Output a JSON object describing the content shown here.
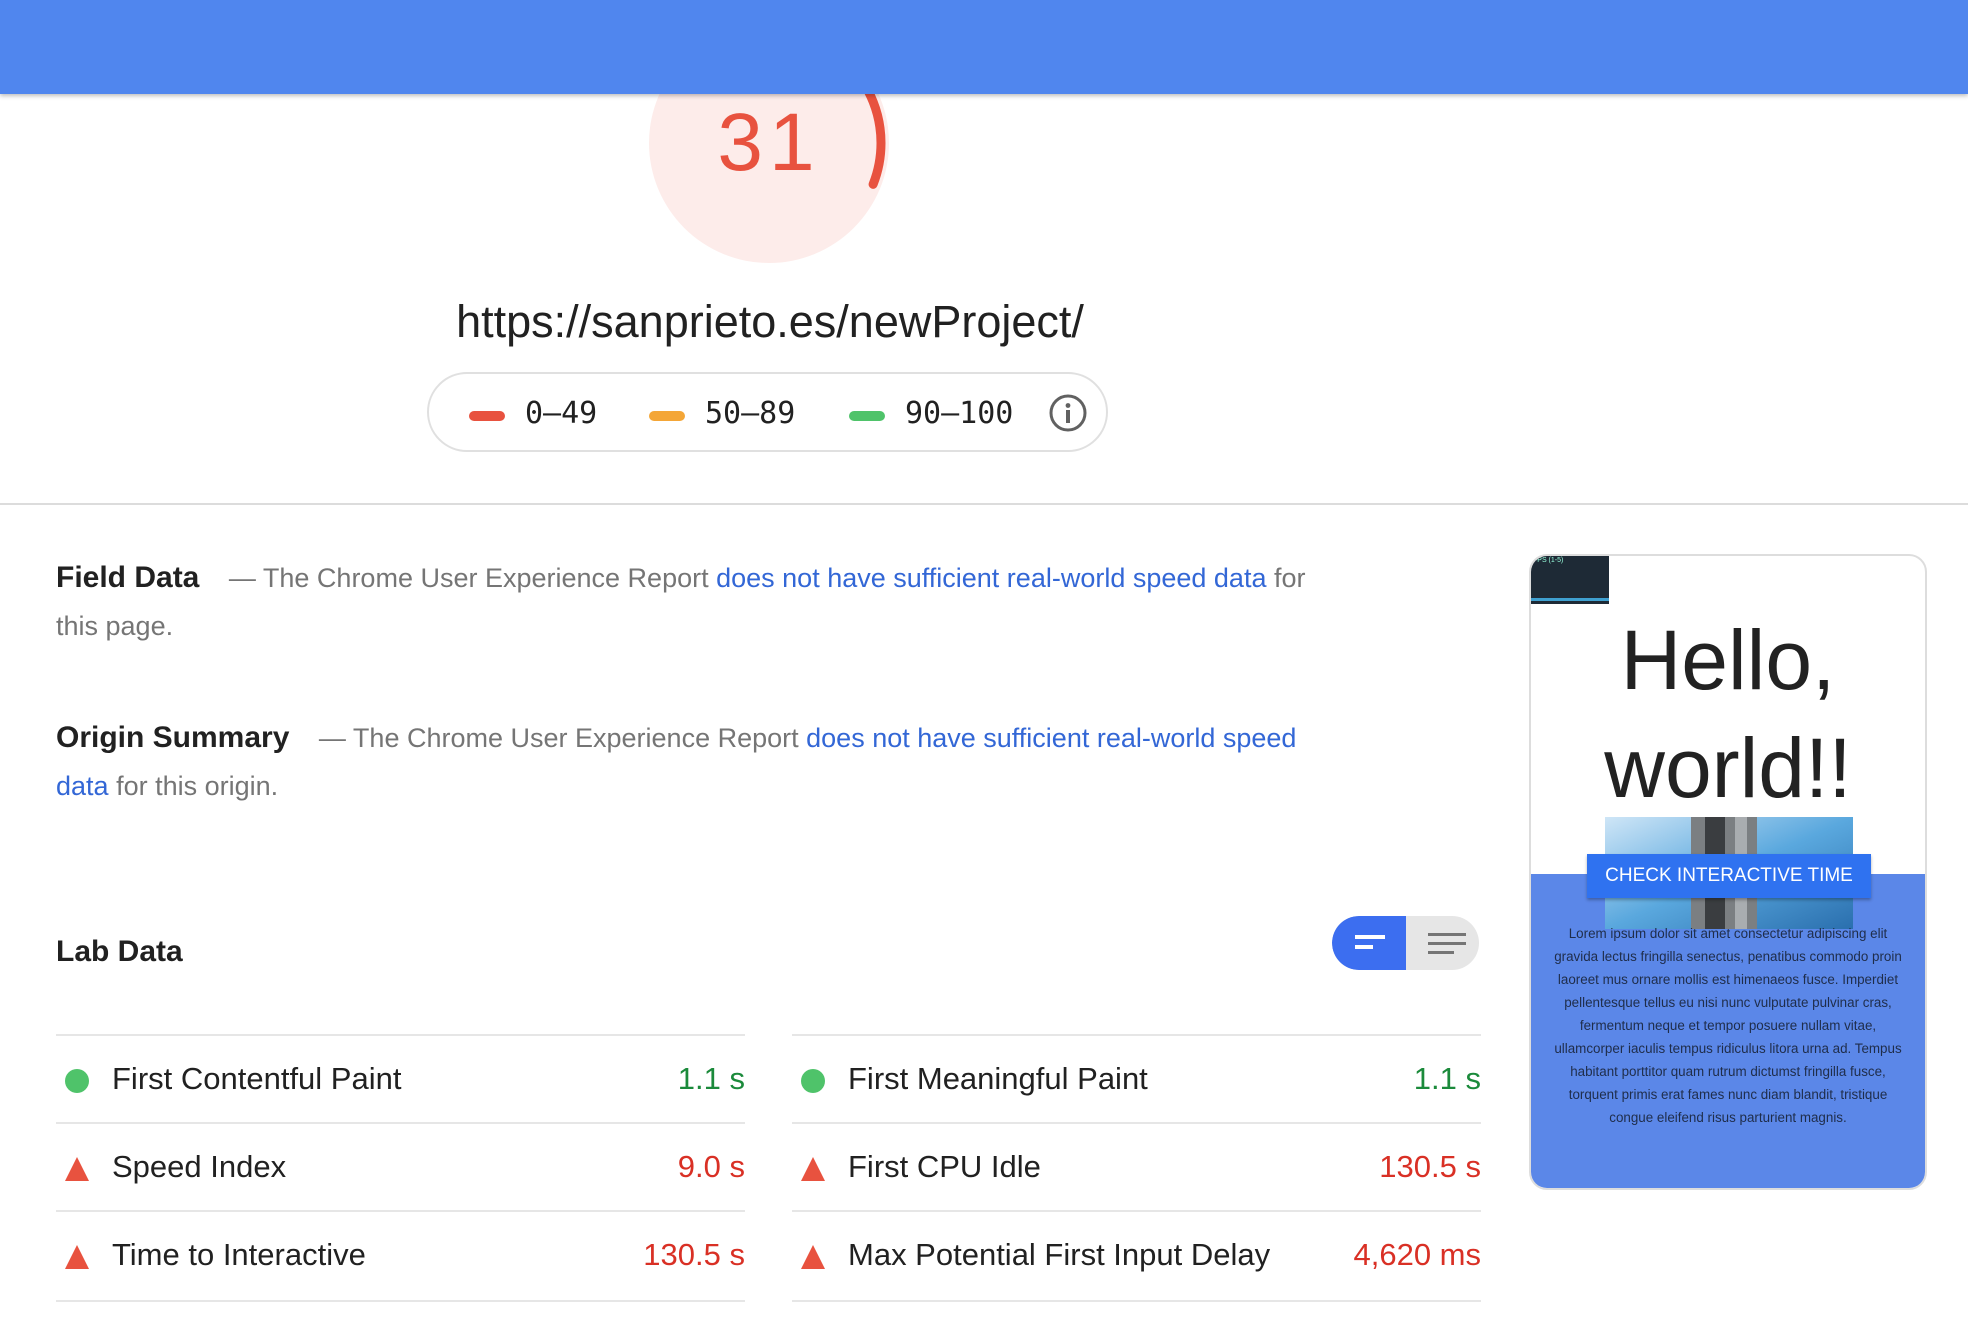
{
  "score": {
    "value": "31",
    "fraction": 0.31,
    "color": "#e8523f"
  },
  "url": "https://sanprieto.es/newProject/",
  "legend": {
    "ranges": [
      {
        "label": "0–49",
        "color": "#e8523f"
      },
      {
        "label": "50–89",
        "color": "#f4a637"
      },
      {
        "label": "90–100",
        "color": "#4fc36a"
      }
    ],
    "info_icon": "info-icon"
  },
  "field_data": {
    "heading": "Field Data",
    "dash": "— The Chrome User Experience Report",
    "link": "does not have sufficient real-world speed data",
    "suffix": "for this page."
  },
  "origin_summary": {
    "heading": "Origin Summary",
    "dash": "— The Chrome User Experience Report",
    "link": "does not have sufficient real-world speed data",
    "suffix": "for this origin."
  },
  "lab_data": {
    "heading": "Lab Data",
    "toggle": {
      "options": [
        "compact-view-icon",
        "list-view-icon"
      ],
      "selected": "compact-view-icon"
    },
    "left_metrics": [
      {
        "name": "First Contentful Paint",
        "value": "1.1 s",
        "status": "good"
      },
      {
        "name": "Speed Index",
        "value": "9.0 s",
        "status": "bad"
      },
      {
        "name": "Time to Interactive",
        "value": "130.5 s",
        "status": "bad"
      }
    ],
    "right_metrics": [
      {
        "name": "First Meaningful Paint",
        "value": "1.1 s",
        "status": "good"
      },
      {
        "name": "First CPU Idle",
        "value": "130.5 s",
        "status": "bad"
      },
      {
        "name": "Max Potential First Input Delay",
        "value": "4,620 ms",
        "status": "bad"
      }
    ]
  },
  "preview": {
    "fps_label": "FPS (1-5)",
    "heading_line1": "Hello,",
    "heading_line2": "world!!",
    "cta": "CHECK INTERACTIVE TIME",
    "body": "Lorem ipsum dolor sit amet consectetur adipiscing elit gravida lectus fringilla senectus, penatibus commodo proin laoreet mus ornare mollis est himenaeos fusce. Imperdiet pellentesque tellus eu nisi nunc vulputate pulvinar cras, fermentum neque et tempor posuere nullam vitae, ullamcorper iaculis tempus ridiculus litora urna ad. Tempus habitant porttitor quam rutrum dictumst fringilla fusce, torquent primis erat fames nunc diam blandit, tristique congue eleifend risus parturient magnis."
  },
  "colors": {
    "header": "#5086ee",
    "good": "#1b8a3b",
    "bad": "#d93025",
    "link": "#3367d6"
  }
}
